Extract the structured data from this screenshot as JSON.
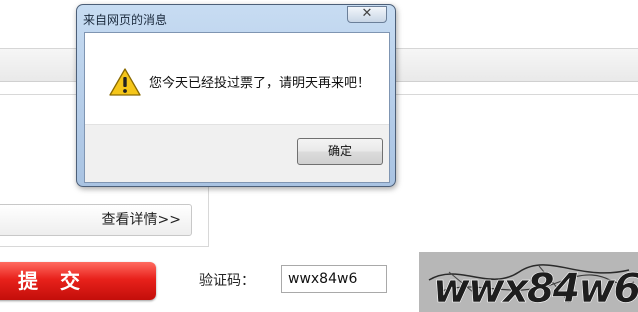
{
  "page": {
    "details_button_label": "查看详情>>",
    "submit_button_label": "提交",
    "captcha_label": "验证码：",
    "captcha_value": "wwx84w6",
    "captcha_image_text": "wwx84w6"
  },
  "dialog": {
    "title": "来自网页的消息",
    "close_glyph": "✕",
    "icon": "warning-icon",
    "message": "您今天已经投过票了，请明天再来吧！",
    "ok_label": "确定"
  },
  "colors": {
    "submit_red": "#e8211b",
    "dialog_frame": "#b4cce8",
    "warning_yellow": "#f5c61a"
  }
}
